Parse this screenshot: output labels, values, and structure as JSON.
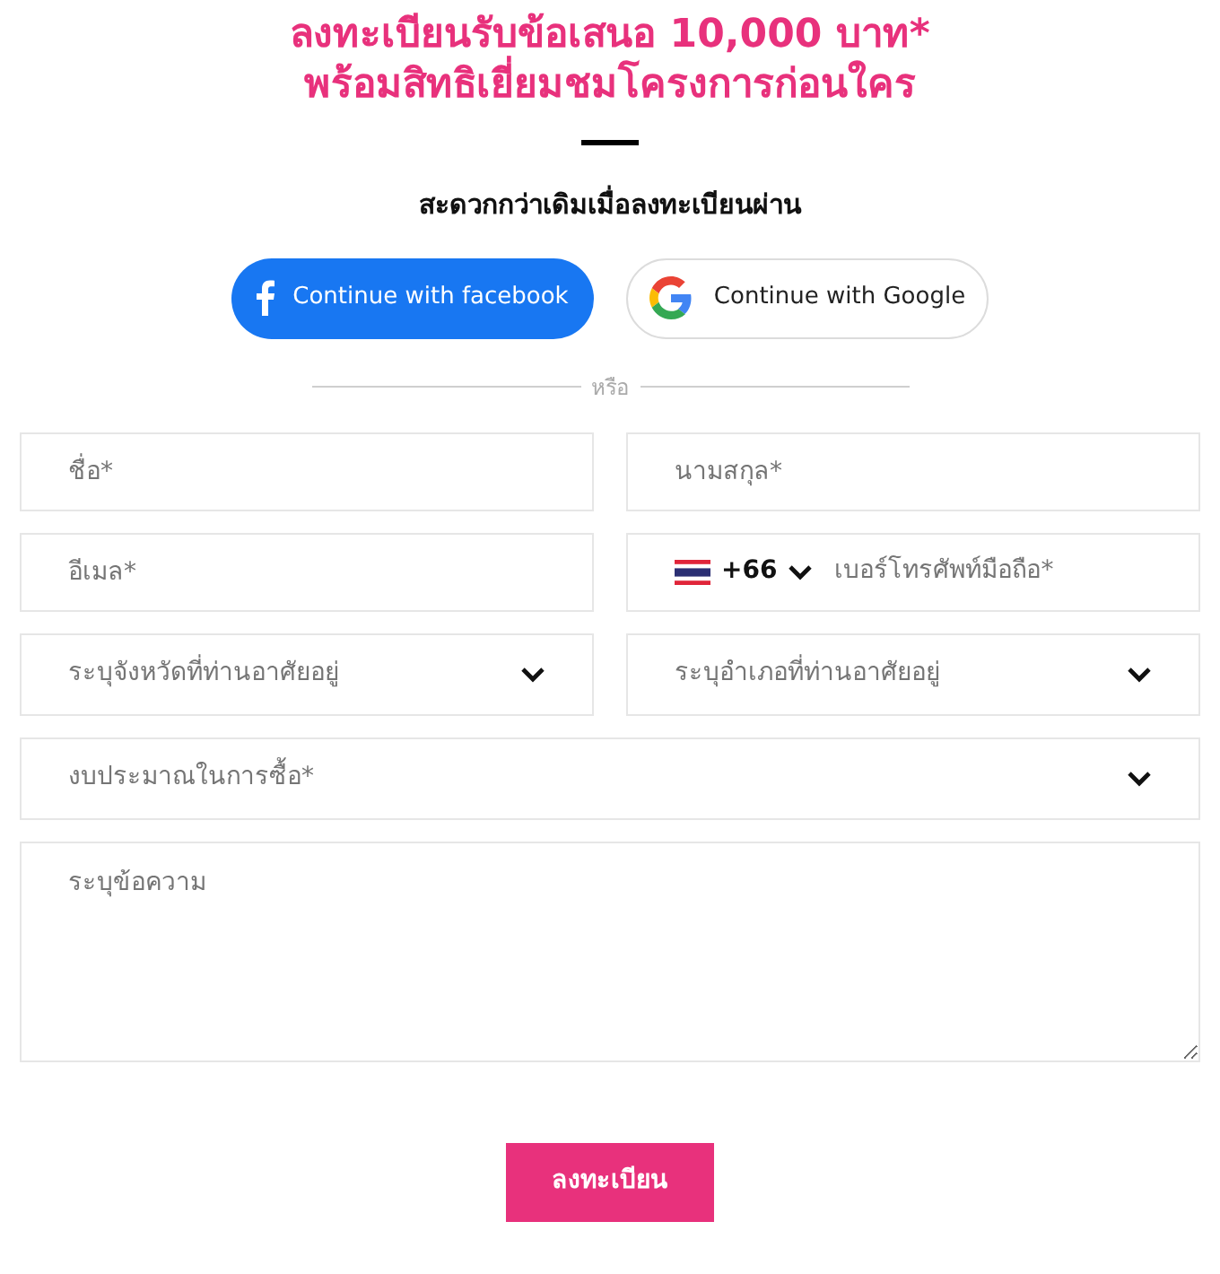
{
  "headline": [
    "ลงทะเบียนรับข้อเสนอ 10,000 บาท*",
    "พร้อมสิทธิเยี่ยมชมโครงการก่อนใคร"
  ],
  "subtitle": "สะดวกกว่าเดิมเมื่อลงทะเบียนผ่าน",
  "social_buttons": [
    {
      "kind": "facebook",
      "label": "Continue with facebook"
    },
    {
      "kind": "google",
      "label": "Continue with Google"
    }
  ],
  "divider_text": "หรือ",
  "field_rows": [
    [
      {
        "kind": "text",
        "placeholder": "ชื่อ*"
      },
      {
        "kind": "text",
        "placeholder": "นามสกุล*"
      }
    ],
    [
      {
        "kind": "text",
        "placeholder": "อีเมล*"
      },
      {
        "kind": "phone",
        "country_code": "+66",
        "placeholder": "เบอร์โทรศัพท์มือถือ*"
      }
    ],
    [
      {
        "kind": "select",
        "placeholder": "ระบุจังหวัดที่ท่านอาศัยอยู่"
      },
      {
        "kind": "select",
        "placeholder": "ระบุอำเภอที่ท่านอาศัยอยู่"
      }
    ],
    [
      {
        "kind": "select",
        "placeholder": "งบประมาณในการซื้อ*"
      }
    ],
    [
      {
        "kind": "textarea",
        "placeholder": "ระบุข้อความ"
      }
    ]
  ],
  "submit_button": "ลงทะเบียน"
}
